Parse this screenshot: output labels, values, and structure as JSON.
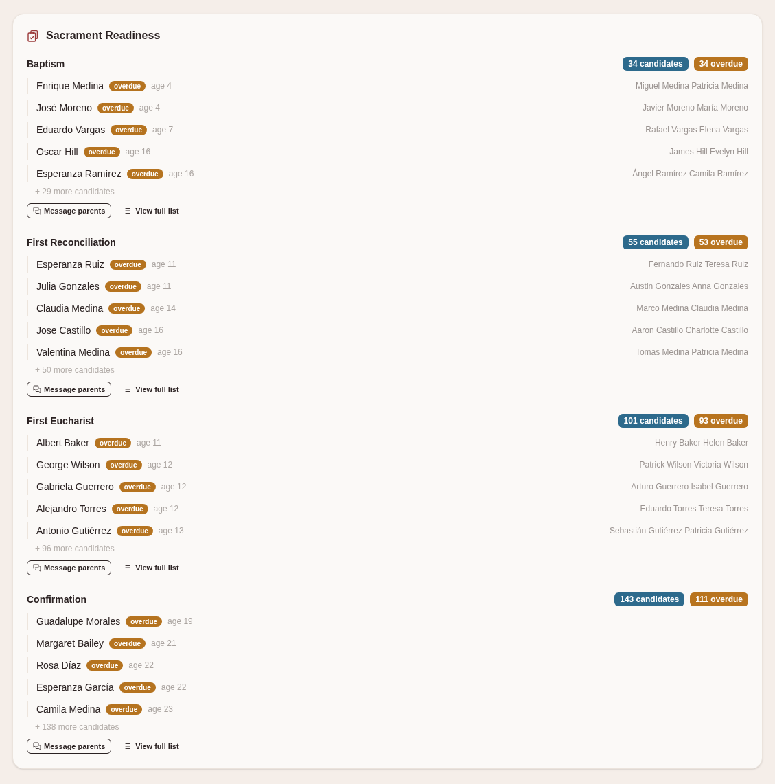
{
  "card": {
    "title": "Sacrament Readiness"
  },
  "sacraments": [
    {
      "name": "Baptism",
      "candidates_badge": "34 candidates",
      "overdue_badge": "34 overdue",
      "candidates": [
        {
          "name": "Enrique Medina",
          "badge": "overdue",
          "age": "age 4",
          "parents": "Miguel Medina Patricia Medina"
        },
        {
          "name": "José Moreno",
          "badge": "overdue",
          "age": "age 4",
          "parents": "Javier Moreno María Moreno"
        },
        {
          "name": "Eduardo Vargas",
          "badge": "overdue",
          "age": "age 7",
          "parents": "Rafael Vargas Elena Vargas"
        },
        {
          "name": "Oscar Hill",
          "badge": "overdue",
          "age": "age 16",
          "parents": "James Hill Evelyn Hill"
        },
        {
          "name": "Esperanza Ramírez",
          "badge": "overdue",
          "age": "age 16",
          "parents": "Ángel Ramírez Camila Ramírez"
        }
      ],
      "more": "+ 29 more candidates",
      "message_button": "Message parents",
      "list_link": "View full list"
    },
    {
      "name": "First Reconciliation",
      "candidates_badge": "55 candidates",
      "overdue_badge": "53 overdue",
      "candidates": [
        {
          "name": "Esperanza Ruiz",
          "badge": "overdue",
          "age": "age 11",
          "parents": "Fernando Ruiz Teresa Ruiz"
        },
        {
          "name": "Julia Gonzales",
          "badge": "overdue",
          "age": "age 11",
          "parents": "Austin Gonzales Anna Gonzales"
        },
        {
          "name": "Claudia Medina",
          "badge": "overdue",
          "age": "age 14",
          "parents": "Marco Medina Claudia Medina"
        },
        {
          "name": "Jose Castillo",
          "badge": "overdue",
          "age": "age 16",
          "parents": "Aaron Castillo Charlotte Castillo"
        },
        {
          "name": "Valentina Medina",
          "badge": "overdue",
          "age": "age 16",
          "parents": "Tomás Medina Patricia Medina"
        }
      ],
      "more": "+ 50 more candidates",
      "message_button": "Message parents",
      "list_link": "View full list"
    },
    {
      "name": "First Eucharist",
      "candidates_badge": "101 candidates",
      "overdue_badge": "93 overdue",
      "candidates": [
        {
          "name": "Albert Baker",
          "badge": "overdue",
          "age": "age 11",
          "parents": "Henry Baker Helen Baker"
        },
        {
          "name": "George Wilson",
          "badge": "overdue",
          "age": "age 12",
          "parents": "Patrick Wilson Victoria Wilson"
        },
        {
          "name": "Gabriela Guerrero",
          "badge": "overdue",
          "age": "age 12",
          "parents": "Arturo Guerrero Isabel Guerrero"
        },
        {
          "name": "Alejandro Torres",
          "badge": "overdue",
          "age": "age 12",
          "parents": "Eduardo Torres Teresa Torres"
        },
        {
          "name": "Antonio Gutiérrez",
          "badge": "overdue",
          "age": "age 13",
          "parents": "Sebastián Gutiérrez Patricia Gutiérrez"
        }
      ],
      "more": "+ 96 more candidates",
      "message_button": "Message parents",
      "list_link": "View full list"
    },
    {
      "name": "Confirmation",
      "candidates_badge": "143 candidates",
      "overdue_badge": "111 overdue",
      "candidates": [
        {
          "name": "Guadalupe Morales",
          "badge": "overdue",
          "age": "age 19"
        },
        {
          "name": "Margaret Bailey",
          "badge": "overdue",
          "age": "age 21"
        },
        {
          "name": "Rosa Díaz",
          "badge": "overdue",
          "age": "age 22"
        },
        {
          "name": "Esperanza García",
          "badge": "overdue",
          "age": "age 22"
        },
        {
          "name": "Camila Medina",
          "badge": "overdue",
          "age": "age 23"
        }
      ],
      "more": "+ 138 more candidates",
      "message_button": "Message parents",
      "list_link": "View full list"
    }
  ]
}
